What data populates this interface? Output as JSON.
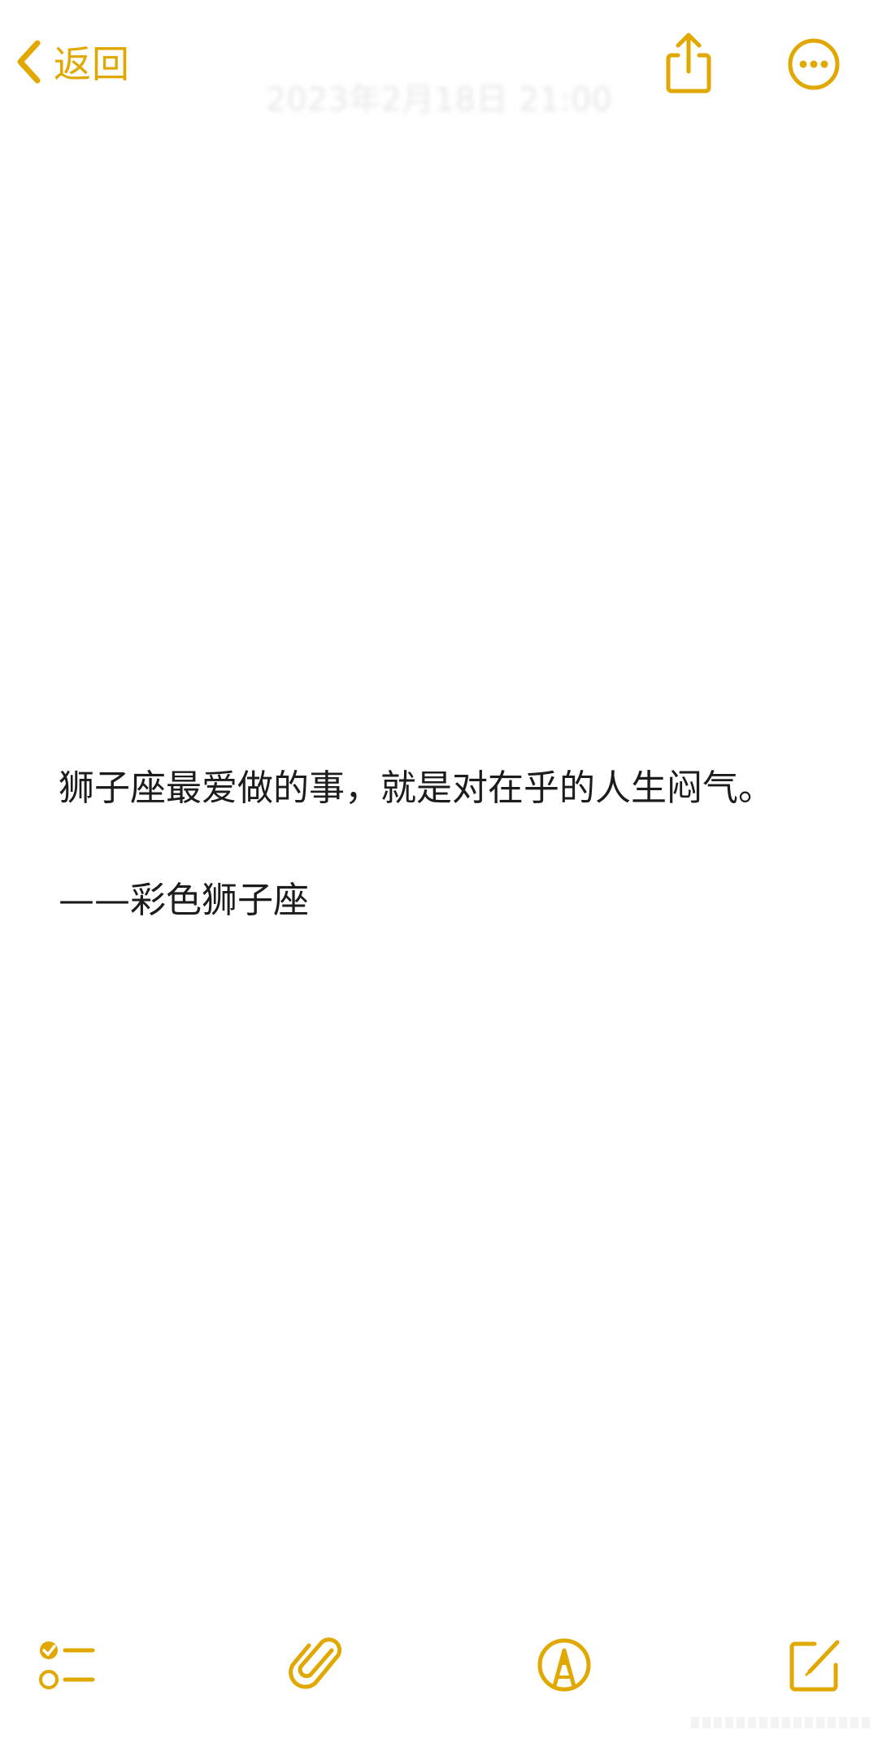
{
  "header": {
    "back_label": "返回",
    "timestamp": "2023年2月18日 21:00",
    "icons": {
      "back": "chevron-left-icon",
      "share": "share-icon",
      "more": "more-icon"
    }
  },
  "note": {
    "lines": [
      "狮子座最爱做的事，就是对在乎的人生闷气。",
      "——彩色狮子座"
    ]
  },
  "toolbar": {
    "icons": [
      "checklist-icon",
      "paperclip-icon",
      "markup-icon",
      "compose-icon"
    ]
  },
  "colors": {
    "accent": "#e0a800",
    "text": "#1c1c1e",
    "background": "#ffffff"
  }
}
